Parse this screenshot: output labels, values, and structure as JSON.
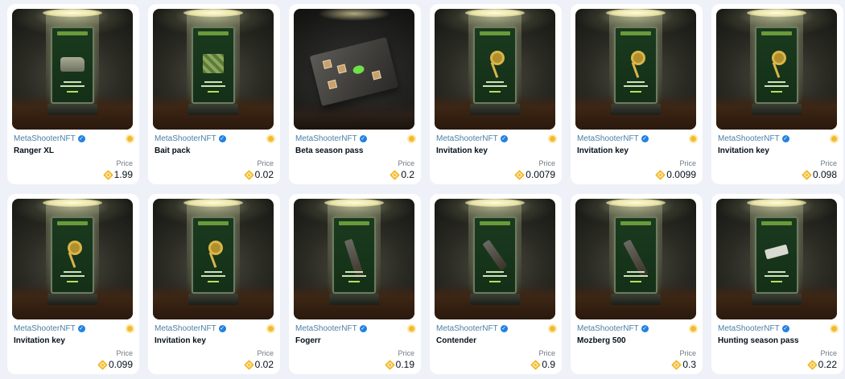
{
  "collection_name": "MetaShooterNFT",
  "price_label": "Price",
  "colors": {
    "background": "#eef1f7",
    "verified": "#2081e2",
    "bnb": "#f3ba2f",
    "collection_text": "#4a7fa6"
  },
  "cards": [
    {
      "name": "Ranger XL",
      "price": "1.99",
      "item_icon": "car-icon"
    },
    {
      "name": "Bait pack",
      "price": "0.02",
      "item_icon": "bait-pack-icon"
    },
    {
      "name": "Beta season pass",
      "price": "0.2",
      "item_icon": "envelope-icon"
    },
    {
      "name": "Invitation key",
      "price": "0.0079",
      "item_icon": "key-icon"
    },
    {
      "name": "Invitation key",
      "price": "0.0099",
      "item_icon": "key-icon"
    },
    {
      "name": "Invitation key",
      "price": "0.098",
      "item_icon": "key-icon"
    },
    {
      "name": "Invitation key",
      "price": "0.099",
      "item_icon": "key-icon"
    },
    {
      "name": "Invitation key",
      "price": "0.02",
      "item_icon": "key-icon"
    },
    {
      "name": "Fogerr",
      "price": "0.19",
      "item_icon": "rifle-icon"
    },
    {
      "name": "Contender",
      "price": "0.9",
      "item_icon": "rifle-icon"
    },
    {
      "name": "Mozberg 500",
      "price": "0.3",
      "item_icon": "shotgun-icon"
    },
    {
      "name": "Hunting season pass",
      "price": "0.22",
      "item_icon": "ticket-icon"
    }
  ]
}
